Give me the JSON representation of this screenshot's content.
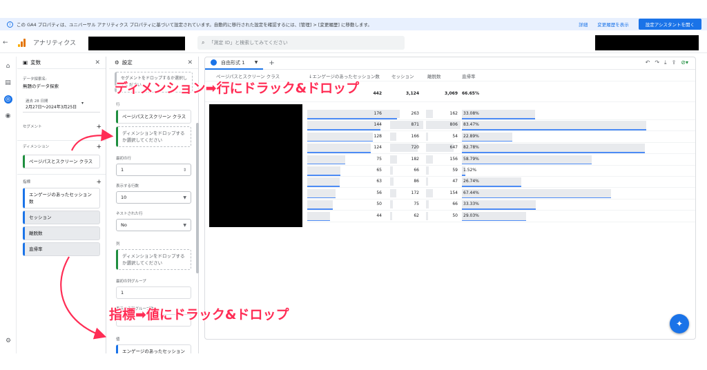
{
  "banner": {
    "message": "この GA4 プロパティは、ユニバーサル アナリティクス プロパティに基づいて設定されています。自動的に移行された設定を確認するには、[管理] > [変更履歴] に移動します。",
    "link_details": "詳細",
    "link_history": "変更履歴を表示",
    "cta": "設定アシスタントを開く"
  },
  "appbar": {
    "title": "アナリティクス",
    "search_placeholder": "「測定 ID」と検索してみてください"
  },
  "variables_panel": {
    "title": "変数",
    "exploration_label": "データ探索名:",
    "exploration_name": "無題のデータ探索",
    "date_label": "過去 28 日間",
    "date_range": "2月27日～2024年3月25日",
    "segments_label": "セグメント",
    "dimensions_label": "ディメンション",
    "dimension_items": [
      "ページパスとスクリーン クラス"
    ],
    "metrics_label": "指標",
    "metric_items": [
      "エンゲージのあったセッション数",
      "セッション",
      "離脱数",
      "直帰率"
    ]
  },
  "settings_panel": {
    "title": "設定",
    "segment_drop": "セグメントをドロップするか選択してください",
    "rows_label": "行",
    "row_item": "ページパスとスクリーン クラス",
    "drop_dimension": "ディメンションをドロップするか選択してください",
    "first_row_label": "最初の行",
    "first_row_value": "1",
    "show_rows_label": "表示する行数",
    "show_rows_value": "10",
    "nested_rows_label": "ネストされた行",
    "nested_rows_value": "No",
    "columns_label": "列",
    "columns_drop": "ディメンションをドロップするか選択してください",
    "first_col_group_label": "最初の列グループ",
    "first_col_group_value": "1",
    "show_col_groups_label": "表示する列グループ数",
    "values_label": "値",
    "value_item": "エンゲージのあったセッション数"
  },
  "workspace": {
    "tab_name": "自由形式 1",
    "add_tab": "+"
  },
  "table": {
    "headers": [
      "ページパスとスクリーン クラス",
      "↓エンゲージのあったセッション数",
      "セッション",
      "離脱数",
      "直帰率"
    ],
    "totals": {
      "engaged": "442",
      "sessions": "3,124",
      "exits": "3,069",
      "bounce": "66.65%"
    },
    "rows": [
      {
        "engaged": "176",
        "sessions": "263",
        "exits": "162",
        "bounce": "33.08%",
        "bounce_rate": 33.08
      },
      {
        "engaged": "144",
        "sessions": "871",
        "exits": "806",
        "bounce": "83.47%",
        "bounce_rate": 83.47
      },
      {
        "engaged": "128",
        "sessions": "166",
        "exits": "54",
        "bounce": "22.89%",
        "bounce_rate": 22.89
      },
      {
        "engaged": "124",
        "sessions": "720",
        "exits": "647",
        "bounce": "82.78%",
        "bounce_rate": 82.78
      },
      {
        "engaged": "75",
        "sessions": "182",
        "exits": "156",
        "bounce": "58.79%",
        "bounce_rate": 58.79
      },
      {
        "engaged": "65",
        "sessions": "66",
        "exits": "59",
        "bounce": "1.52%",
        "bounce_rate": 1.52
      },
      {
        "engaged": "63",
        "sessions": "86",
        "exits": "47",
        "bounce": "26.74%",
        "bounce_rate": 26.74
      },
      {
        "engaged": "56",
        "sessions": "172",
        "exits": "154",
        "bounce": "67.44%",
        "bounce_rate": 67.44
      },
      {
        "engaged": "50",
        "sessions": "75",
        "exits": "66",
        "bounce": "33.33%",
        "bounce_rate": 33.33
      },
      {
        "engaged": "44",
        "sessions": "62",
        "exits": "50",
        "bounce": "29.03%",
        "bounce_rate": 29.03
      }
    ]
  },
  "annotations": {
    "top": "ディメンション➡行にドラック&ドロップ",
    "bottom": "指標➡値にドラック&ドロップ",
    "color": "#ff2d55"
  },
  "colors": {
    "accent": "#1a73e8",
    "dimension": "#1e8e3e",
    "bar": "#e8eaed"
  },
  "icons": [
    "info-icon",
    "back-arrow-icon",
    "analytics-logo",
    "search-icon",
    "home-icon",
    "reports-icon",
    "explore-icon",
    "advertising-icon",
    "admin-gear-icon",
    "close-icon",
    "add-icon",
    "undo-icon",
    "redo-icon",
    "download-icon",
    "share-icon",
    "check-icon",
    "insights-fab-icon"
  ]
}
